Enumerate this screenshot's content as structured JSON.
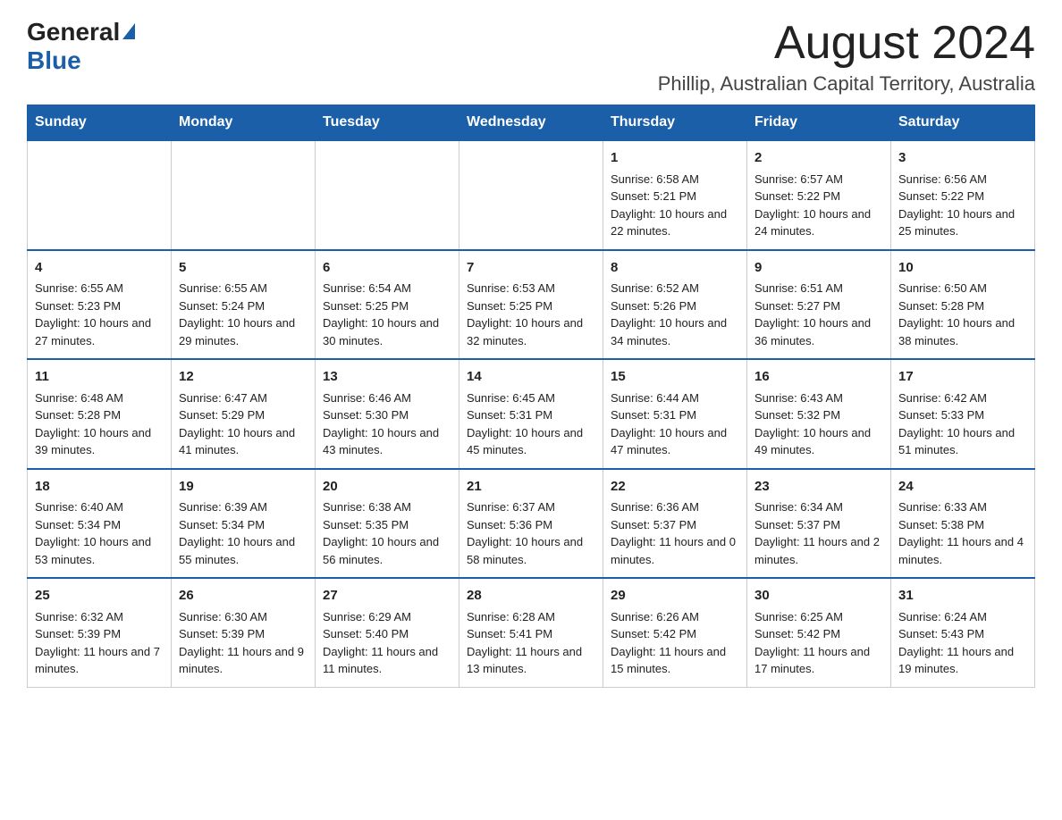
{
  "header": {
    "logo_text_general": "General",
    "logo_text_blue": "Blue",
    "month_title": "August 2024",
    "location": "Phillip, Australian Capital Territory, Australia"
  },
  "calendar": {
    "days_of_week": [
      "Sunday",
      "Monday",
      "Tuesday",
      "Wednesday",
      "Thursday",
      "Friday",
      "Saturday"
    ],
    "weeks": [
      [
        {
          "day": "",
          "info": ""
        },
        {
          "day": "",
          "info": ""
        },
        {
          "day": "",
          "info": ""
        },
        {
          "day": "",
          "info": ""
        },
        {
          "day": "1",
          "info": "Sunrise: 6:58 AM\nSunset: 5:21 PM\nDaylight: 10 hours and 22 minutes."
        },
        {
          "day": "2",
          "info": "Sunrise: 6:57 AM\nSunset: 5:22 PM\nDaylight: 10 hours and 24 minutes."
        },
        {
          "day": "3",
          "info": "Sunrise: 6:56 AM\nSunset: 5:22 PM\nDaylight: 10 hours and 25 minutes."
        }
      ],
      [
        {
          "day": "4",
          "info": "Sunrise: 6:55 AM\nSunset: 5:23 PM\nDaylight: 10 hours and 27 minutes."
        },
        {
          "day": "5",
          "info": "Sunrise: 6:55 AM\nSunset: 5:24 PM\nDaylight: 10 hours and 29 minutes."
        },
        {
          "day": "6",
          "info": "Sunrise: 6:54 AM\nSunset: 5:25 PM\nDaylight: 10 hours and 30 minutes."
        },
        {
          "day": "7",
          "info": "Sunrise: 6:53 AM\nSunset: 5:25 PM\nDaylight: 10 hours and 32 minutes."
        },
        {
          "day": "8",
          "info": "Sunrise: 6:52 AM\nSunset: 5:26 PM\nDaylight: 10 hours and 34 minutes."
        },
        {
          "day": "9",
          "info": "Sunrise: 6:51 AM\nSunset: 5:27 PM\nDaylight: 10 hours and 36 minutes."
        },
        {
          "day": "10",
          "info": "Sunrise: 6:50 AM\nSunset: 5:28 PM\nDaylight: 10 hours and 38 minutes."
        }
      ],
      [
        {
          "day": "11",
          "info": "Sunrise: 6:48 AM\nSunset: 5:28 PM\nDaylight: 10 hours and 39 minutes."
        },
        {
          "day": "12",
          "info": "Sunrise: 6:47 AM\nSunset: 5:29 PM\nDaylight: 10 hours and 41 minutes."
        },
        {
          "day": "13",
          "info": "Sunrise: 6:46 AM\nSunset: 5:30 PM\nDaylight: 10 hours and 43 minutes."
        },
        {
          "day": "14",
          "info": "Sunrise: 6:45 AM\nSunset: 5:31 PM\nDaylight: 10 hours and 45 minutes."
        },
        {
          "day": "15",
          "info": "Sunrise: 6:44 AM\nSunset: 5:31 PM\nDaylight: 10 hours and 47 minutes."
        },
        {
          "day": "16",
          "info": "Sunrise: 6:43 AM\nSunset: 5:32 PM\nDaylight: 10 hours and 49 minutes."
        },
        {
          "day": "17",
          "info": "Sunrise: 6:42 AM\nSunset: 5:33 PM\nDaylight: 10 hours and 51 minutes."
        }
      ],
      [
        {
          "day": "18",
          "info": "Sunrise: 6:40 AM\nSunset: 5:34 PM\nDaylight: 10 hours and 53 minutes."
        },
        {
          "day": "19",
          "info": "Sunrise: 6:39 AM\nSunset: 5:34 PM\nDaylight: 10 hours and 55 minutes."
        },
        {
          "day": "20",
          "info": "Sunrise: 6:38 AM\nSunset: 5:35 PM\nDaylight: 10 hours and 56 minutes."
        },
        {
          "day": "21",
          "info": "Sunrise: 6:37 AM\nSunset: 5:36 PM\nDaylight: 10 hours and 58 minutes."
        },
        {
          "day": "22",
          "info": "Sunrise: 6:36 AM\nSunset: 5:37 PM\nDaylight: 11 hours and 0 minutes."
        },
        {
          "day": "23",
          "info": "Sunrise: 6:34 AM\nSunset: 5:37 PM\nDaylight: 11 hours and 2 minutes."
        },
        {
          "day": "24",
          "info": "Sunrise: 6:33 AM\nSunset: 5:38 PM\nDaylight: 11 hours and 4 minutes."
        }
      ],
      [
        {
          "day": "25",
          "info": "Sunrise: 6:32 AM\nSunset: 5:39 PM\nDaylight: 11 hours and 7 minutes."
        },
        {
          "day": "26",
          "info": "Sunrise: 6:30 AM\nSunset: 5:39 PM\nDaylight: 11 hours and 9 minutes."
        },
        {
          "day": "27",
          "info": "Sunrise: 6:29 AM\nSunset: 5:40 PM\nDaylight: 11 hours and 11 minutes."
        },
        {
          "day": "28",
          "info": "Sunrise: 6:28 AM\nSunset: 5:41 PM\nDaylight: 11 hours and 13 minutes."
        },
        {
          "day": "29",
          "info": "Sunrise: 6:26 AM\nSunset: 5:42 PM\nDaylight: 11 hours and 15 minutes."
        },
        {
          "day": "30",
          "info": "Sunrise: 6:25 AM\nSunset: 5:42 PM\nDaylight: 11 hours and 17 minutes."
        },
        {
          "day": "31",
          "info": "Sunrise: 6:24 AM\nSunset: 5:43 PM\nDaylight: 11 hours and 19 minutes."
        }
      ]
    ]
  }
}
